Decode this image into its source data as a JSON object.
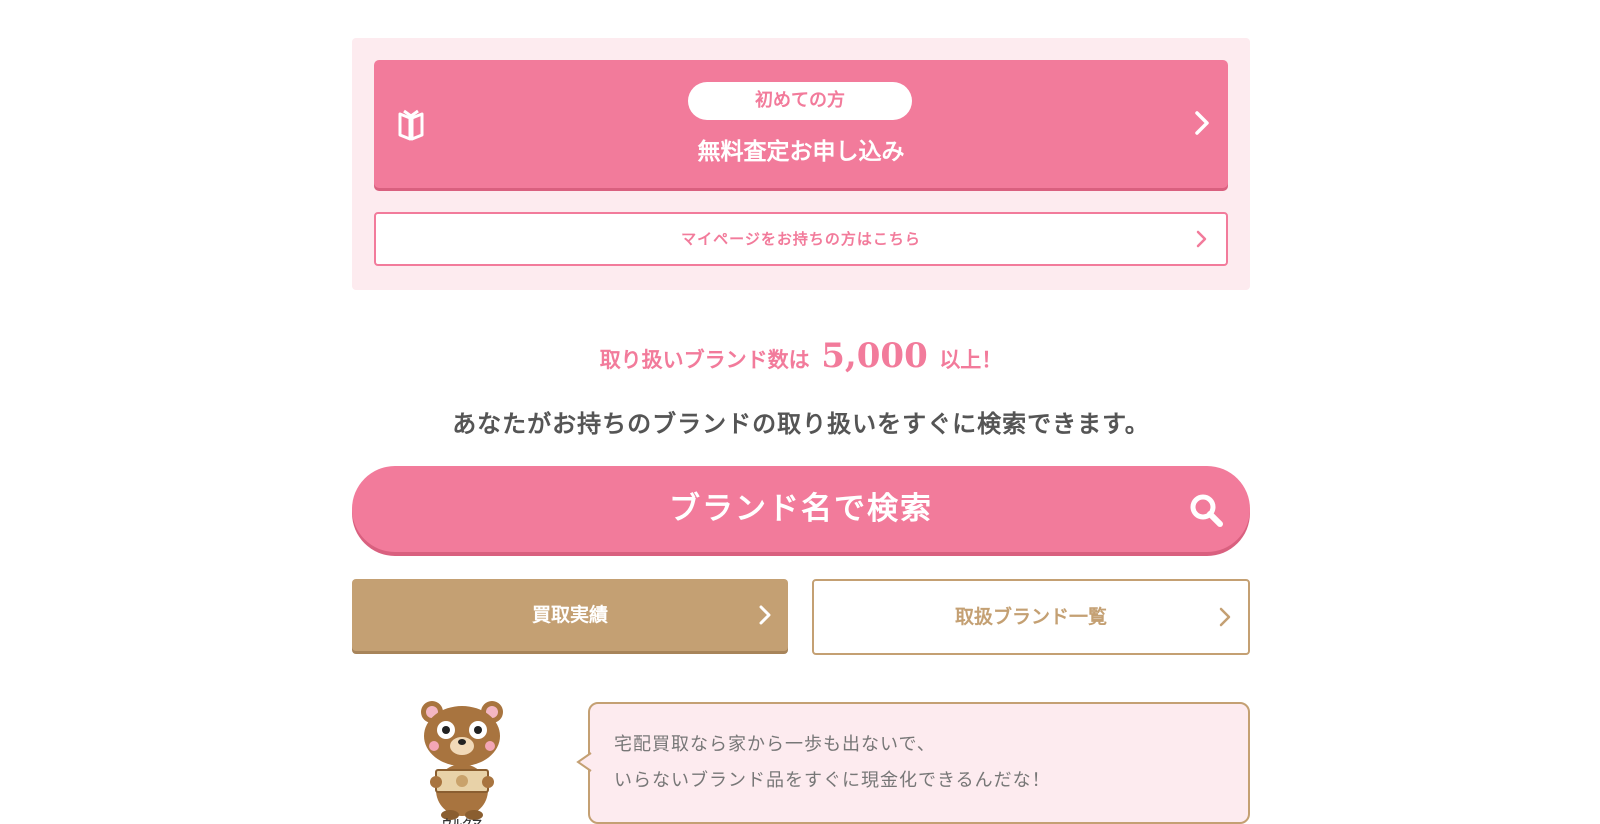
{
  "cta": {
    "badge": "初めての方",
    "apply_label": "無料査定お申し込み",
    "mypage_label": "マイページをお持ちの方はこちら"
  },
  "brand_info": {
    "count_prefix": "取り扱いブランド数は",
    "count_value": "5,000",
    "count_suffix": "以上！",
    "description": "あなたがお持ちのブランドの取り扱いをすぐに検索できます。"
  },
  "search": {
    "label": "ブランド名で検索"
  },
  "links": {
    "results_label": "買取実績",
    "brandlist_label": "取扱ブランド一覧"
  },
  "mascot": {
    "name": "ウルクマ",
    "speech_line1": "宅配買取なら家から一歩も出ないで、",
    "speech_line2": "いらないブランド品をすぐに現金化できるんだな！"
  },
  "colors": {
    "pink": "#f27b9b",
    "pink_light": "#fdebef",
    "gold": "#c4a073",
    "text_dark": "#555555"
  },
  "icons": [
    "book-icon",
    "chevron-right-icon",
    "search-icon",
    "mascot-bear"
  ]
}
